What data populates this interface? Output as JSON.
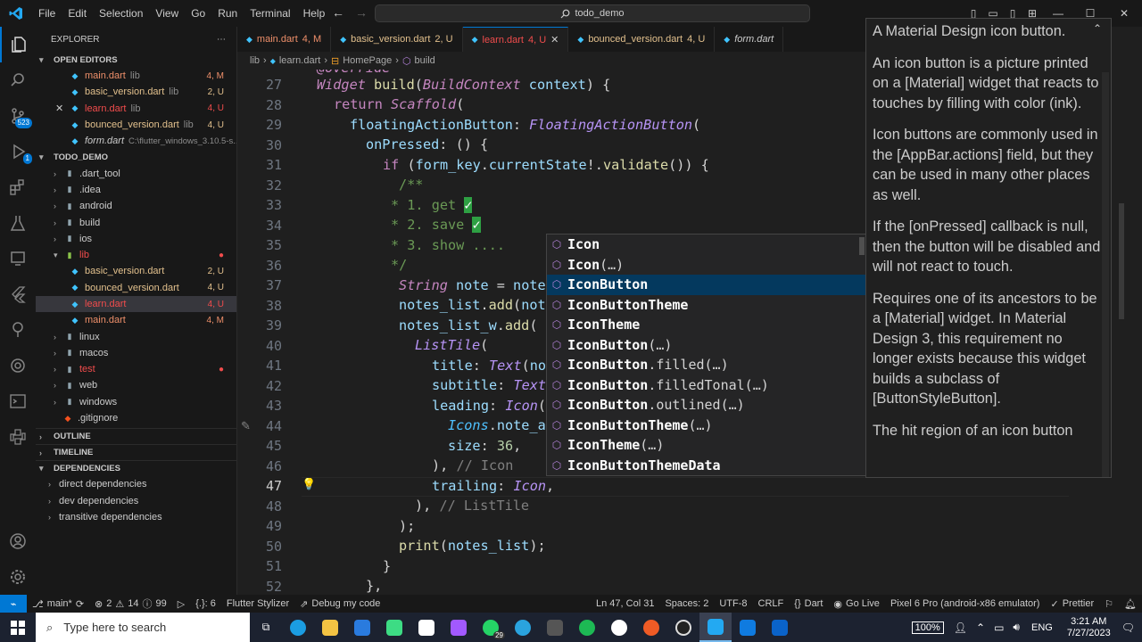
{
  "menu": [
    "File",
    "Edit",
    "Selection",
    "View",
    "Go",
    "Run",
    "Terminal",
    "Help"
  ],
  "search": "todo_demo",
  "explorer": {
    "title": "EXPLORER",
    "open_editors": "OPEN EDITORS",
    "project": "TODO_DEMO",
    "outline": "OUTLINE",
    "timeline": "TIMELINE",
    "dependencies": "DEPENDENCIES"
  },
  "open_editors": [
    {
      "name": "main.dart",
      "dir": "lib",
      "status": "4, M"
    },
    {
      "name": "basic_version.dart",
      "dir": "lib",
      "status": "2, U"
    },
    {
      "name": "learn.dart",
      "dir": "lib",
      "status": "4, U"
    },
    {
      "name": "bounced_version.dart",
      "dir": "lib",
      "status": "4, U"
    },
    {
      "name": "form.dart",
      "dir": "C:\\flutter_windows_3.10.5-s...",
      "status": ""
    }
  ],
  "tree": [
    {
      "name": ".dart_tool",
      "type": "folder"
    },
    {
      "name": ".idea",
      "type": "folder"
    },
    {
      "name": "android",
      "type": "folder"
    },
    {
      "name": "build",
      "type": "folder"
    },
    {
      "name": "ios",
      "type": "folder"
    },
    {
      "name": "lib",
      "type": "folder-open"
    },
    {
      "name": "basic_version.dart",
      "status": "2, U"
    },
    {
      "name": "bounced_version.dart",
      "status": "4, U"
    },
    {
      "name": "learn.dart",
      "status": "4, U"
    },
    {
      "name": "main.dart",
      "status": "4, M"
    },
    {
      "name": "linux",
      "type": "folder"
    },
    {
      "name": "macos",
      "type": "folder"
    },
    {
      "name": "test",
      "type": "folder"
    },
    {
      "name": "web",
      "type": "folder"
    },
    {
      "name": "windows",
      "type": "folder"
    },
    {
      "name": ".gitignore",
      "type": "file"
    }
  ],
  "deps": [
    "direct dependencies",
    "dev dependencies",
    "transitive dependencies"
  ],
  "activity_badges": {
    "scm": "523",
    "run": "1"
  },
  "tabs": [
    {
      "name": "main.dart",
      "status": "4, M"
    },
    {
      "name": "basic_version.dart",
      "status": "2, U"
    },
    {
      "name": "learn.dart",
      "status": "4, U"
    },
    {
      "name": "bounced_version.dart",
      "status": "4, U"
    },
    {
      "name": "form.dart",
      "status": ""
    }
  ],
  "breadcrumbs": [
    "lib",
    "learn.dart",
    "HomePage",
    "build"
  ],
  "line_numbers": [
    "27",
    "28",
    "29",
    "30",
    "31",
    "32",
    "33",
    "34",
    "35",
    "36",
    "37",
    "38",
    "39",
    "40",
    "41",
    "42",
    "43",
    "44",
    "45",
    "46",
    "47",
    "48",
    "49",
    "50",
    "51",
    "52"
  ],
  "suggestions": [
    {
      "bold": "Icon",
      "rest": ""
    },
    {
      "bold": "Icon",
      "rest": "(…)"
    },
    {
      "bold": "IconButton",
      "rest": ""
    },
    {
      "bold": "IconButtonTheme",
      "rest": ""
    },
    {
      "bold": "IconTheme",
      "rest": ""
    },
    {
      "bold": "IconButton",
      "rest": "(…)"
    },
    {
      "bold": "IconButton",
      "rest": ".filled(…)"
    },
    {
      "bold": "IconButton",
      "rest": ".filledTonal(…)"
    },
    {
      "bold": "IconButton",
      "rest": ".outlined(…)"
    },
    {
      "bold": "IconButtonTheme",
      "rest": "(…)"
    },
    {
      "bold": "IconTheme",
      "rest": "(…)"
    },
    {
      "bold": "IconButtonThemeData",
      "rest": ""
    }
  ],
  "doc": [
    "A Material Design icon button.",
    "An icon button is a picture printed on a [Material] widget that reacts to touches by filling with color (ink).",
    "Icon buttons are commonly used in the [AppBar.actions] field, but they can be used in many other places as well.",
    "If the [onPressed] callback is null, then the button will be disabled and will not react to touch.",
    "Requires one of its ancestors to be a [Material] widget. In Material Design 3, this requirement no longer exists because this widget builds a subclass of [ButtonStyleButton].",
    "The hit region of an icon button"
  ],
  "status": {
    "branch": "main*",
    "errors": "2",
    "warnings": "14",
    "infos": "99",
    "cursor_ctx": "{.}: 6",
    "stylizer": "Flutter Stylizer",
    "debug": "Debug my code",
    "position": "Ln 47, Col 31",
    "spaces": "Spaces: 2",
    "encoding": "UTF-8",
    "eol": "CRLF",
    "lang": "Dart",
    "golive": "Go Live",
    "device": "Pixel 6 Pro (android-x86 emulator)",
    "prettier": "Prettier"
  },
  "taskbar": {
    "search": "Type here to search",
    "battery": "100%",
    "lang": "ENG",
    "time": "3:21 AM",
    "date": "7/27/2023",
    "whatsapp_badge": "29"
  }
}
